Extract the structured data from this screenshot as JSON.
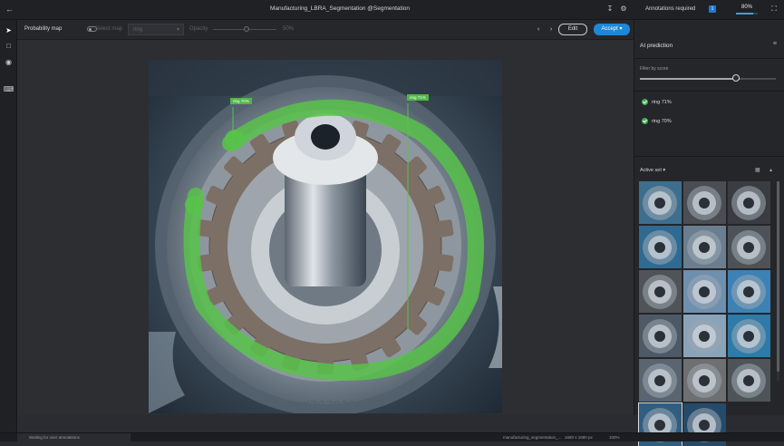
{
  "header": {
    "title": "Manufacturing_LBRA_Segmentation @Segmentation",
    "annotations_required_label": "Annotations required",
    "annotations_required_count": "1",
    "progress_label": "80%",
    "progress_value": 0.8
  },
  "toolbar": {
    "probability_map_label": "Probability map",
    "select_map_label": "Select map",
    "select_map_value": "ring",
    "opacity_label": "Opacity",
    "opacity_value": "50%",
    "edit_label": "Edit",
    "accept_label": "Accept"
  },
  "canvas": {
    "labels": [
      "ring 70%",
      "ring 71%"
    ],
    "segmentation_color": "#58c24a"
  },
  "right_panel": {
    "title": "AI prediction",
    "filter_label": "Filter by score",
    "predictions": [
      {
        "label": "ring 71%"
      },
      {
        "label": "ring 70%"
      }
    ],
    "active_set_label": "Active set"
  },
  "status": {
    "working_text": "Waiting for user annotations",
    "file_name": "manufacturing_segmentation_...",
    "resolution": "1680 x 1680 px",
    "zoom": "100%"
  },
  "colors": {
    "accent": "#1e88d8",
    "success": "#3fae5a",
    "background": "#2a2c31"
  }
}
